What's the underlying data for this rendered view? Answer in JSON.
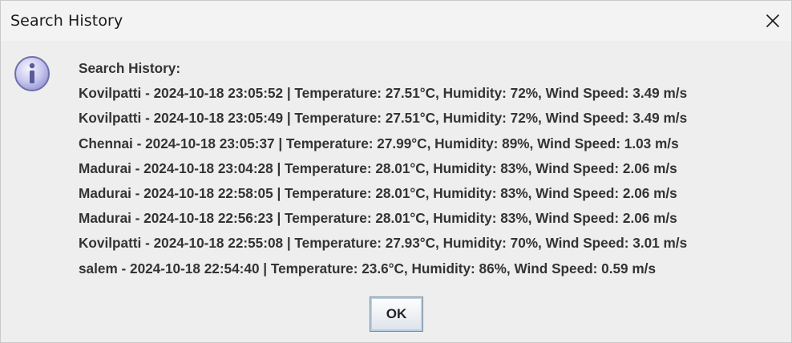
{
  "window": {
    "title": "Search History"
  },
  "dialog": {
    "icon": "info-icon",
    "heading": "Search History:",
    "entries": [
      "Kovilpatti - 2024-10-18 23:05:52 | Temperature: 27.51°C, Humidity: 72%, Wind Speed: 3.49 m/s",
      "Kovilpatti - 2024-10-18 23:05:49 | Temperature: 27.51°C, Humidity: 72%, Wind Speed: 3.49 m/s",
      "Chennai - 2024-10-18 23:05:37 | Temperature: 27.99°C, Humidity: 89%, Wind Speed: 1.03 m/s",
      "Madurai - 2024-10-18 23:04:28 | Temperature: 28.01°C, Humidity: 83%, Wind Speed: 2.06 m/s",
      "Madurai - 2024-10-18 22:58:05 | Temperature: 28.01°C, Humidity: 83%, Wind Speed: 2.06 m/s",
      "Madurai - 2024-10-18 22:56:23 | Temperature: 28.01°C, Humidity: 83%, Wind Speed: 2.06 m/s",
      "Kovilpatti - 2024-10-18 22:55:08 | Temperature: 27.93°C, Humidity: 70%, Wind Speed: 3.01 m/s",
      "salem - 2024-10-18 22:54:40 | Temperature: 23.6°C, Humidity: 86%, Wind Speed: 0.59 m/s"
    ],
    "ok_label": "OK"
  },
  "colors": {
    "background": "#eeeeee",
    "titlebar": "#f3f3f3",
    "text": "#333333",
    "icon_fill": "#c8c8f0",
    "icon_stroke": "#7070b0"
  }
}
